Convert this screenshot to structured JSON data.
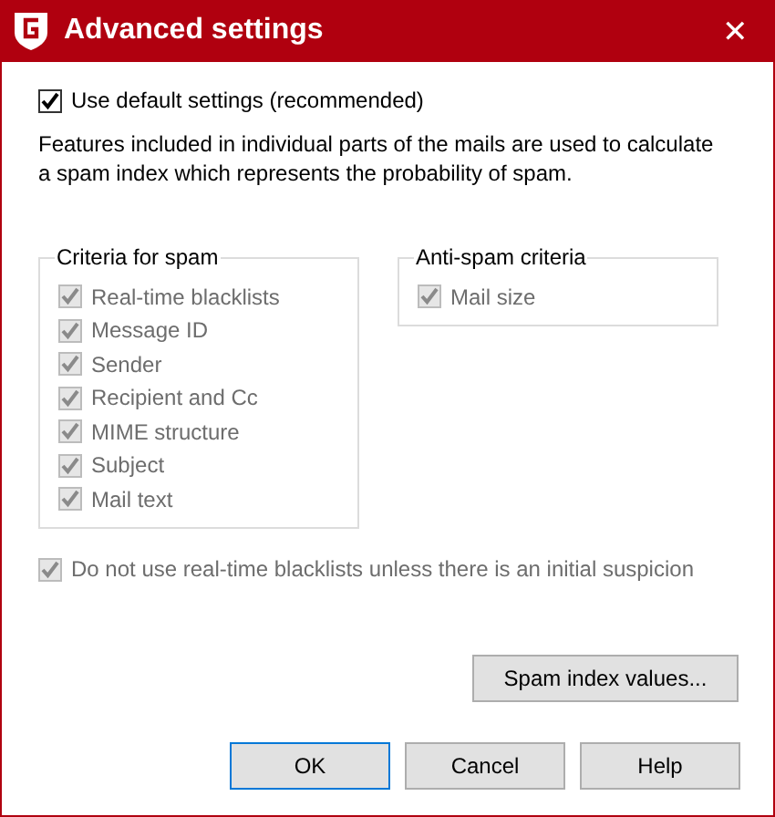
{
  "window": {
    "title": "Advanced settings",
    "close": "✕"
  },
  "default_settings": {
    "label": "Use default settings (recommended)",
    "checked": true,
    "disabled": false
  },
  "description": "Features included in individual parts of the mails are used to calculate a spam index which represents the probability of spam.",
  "groups": [
    {
      "title": "Criteria for spam",
      "items": [
        {
          "label": "Real-time blacklists",
          "checked": true,
          "disabled": true
        },
        {
          "label": "Message ID",
          "checked": true,
          "disabled": true
        },
        {
          "label": "Sender",
          "checked": true,
          "disabled": true
        },
        {
          "label": "Recipient and Cc",
          "checked": true,
          "disabled": true
        },
        {
          "label": "MIME structure",
          "checked": true,
          "disabled": true
        },
        {
          "label": "Subject",
          "checked": true,
          "disabled": true
        },
        {
          "label": "Mail text",
          "checked": true,
          "disabled": true
        }
      ]
    },
    {
      "title": "Anti-spam criteria",
      "items": [
        {
          "label": "Mail size",
          "checked": true,
          "disabled": true
        }
      ]
    }
  ],
  "blacklist_option": {
    "label": "Do not use real-time blacklists unless there is an initial suspicion",
    "checked": true,
    "disabled": true
  },
  "spam_index_button": "Spam index values...",
  "buttons": [
    {
      "label": "OK",
      "default": true
    },
    {
      "label": "Cancel",
      "default": false
    },
    {
      "label": "Help",
      "default": false
    }
  ]
}
